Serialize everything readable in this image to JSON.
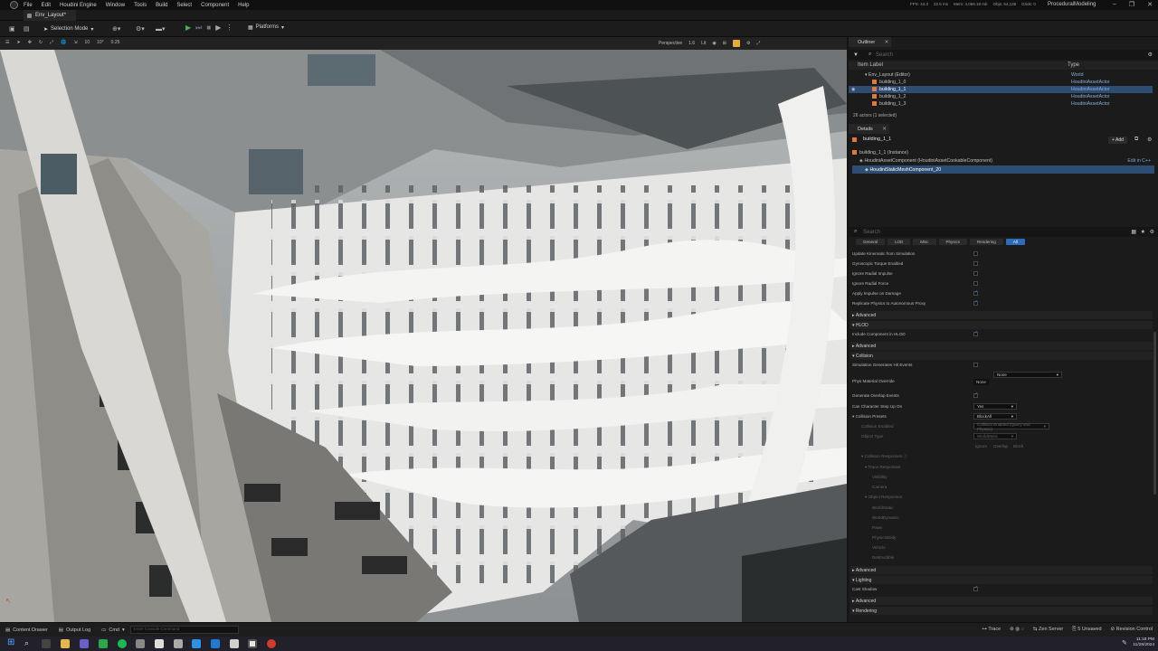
{
  "menubar": {
    "items": [
      "File",
      "Edit",
      "Houdini Engine",
      "Window",
      "Tools",
      "Build",
      "Select",
      "Component",
      "Help"
    ],
    "stats": {
      "fps": "FPS: 44.3",
      "ms": "22.6 ms",
      "mem": "Mem: 4,069.19 mb",
      "objs": "Objs: 54,138",
      "grids": "Grids: 0"
    },
    "project": "ProceduralModeling"
  },
  "level_tab": {
    "label": "Env_Layout*"
  },
  "toolbar": {
    "mode_label": "Selection Mode",
    "platforms_label": "Platforms"
  },
  "viewport_bar": {
    "perspective": "Perspective",
    "lit": "Lit",
    "scale": "1.6",
    "grid_snap": "10",
    "rot_snap": "10°",
    "scale_snap": "0.25"
  },
  "outliner": {
    "tab_label": "Outliner",
    "search_placeholder": "Search",
    "col_label": "Item Label",
    "col_type": "Type",
    "rows": [
      {
        "label": "Env_Layout (Editor)",
        "type": "World"
      },
      {
        "label": "building_1_0",
        "type": "HoudiniAssetActor"
      },
      {
        "label": "building_1_1",
        "type": "HoudiniAssetActor"
      },
      {
        "label": "building_1_2",
        "type": "HoudiniAssetActor"
      },
      {
        "label": "building_1_3",
        "type": "HoudiniAssetActor"
      }
    ],
    "footer": "26 actors (1 selected)"
  },
  "details": {
    "tab_label": "Details",
    "actor_name": "building_1_1",
    "add_label": "+ Add",
    "components": [
      {
        "label": "building_1_1 (Instance)"
      },
      {
        "label": "HoudiniAssetComponent (HoudiniAssetCookableComponent)",
        "extra": "Edit in C++"
      },
      {
        "label": "HoudiniStaticMeshComponent_20"
      }
    ],
    "search_placeholder": "Search",
    "filters": [
      "General",
      "LOD",
      "Misc",
      "Physics",
      "Rendering",
      "All"
    ],
    "physics_props": [
      "Update Kinematic from Simulation",
      "Gyroscopic Torque Enabled",
      "Ignore Radial Impulse",
      "Ignore Radial Force",
      "Apply Impulse on Damage",
      "Replicate Physics to Autonomous Proxy"
    ],
    "sections": {
      "advanced": "Advanced",
      "hlod": "HLOD",
      "hlod_prop": "Include Component in HLOD",
      "collision": "Collision",
      "lighting": "Lighting",
      "rendering": "Rendering"
    },
    "collision_props": {
      "sim_hit": "Simulation Generates Hit Events",
      "phys_mat": "Phys Material Override",
      "phys_mat_value": "None",
      "gen_overlap": "Generate Overlap Events",
      "step_up": "Can Character Step Up On",
      "step_up_value": "Yes",
      "presets": "Collision Presets",
      "presets_value": "BlockAll",
      "enabled": "Collision Enabled",
      "enabled_value": "Collision Enabled (Query and Physics)",
      "obj_type": "Object Type",
      "obj_type_value": "WorldStatic",
      "col_ignore": "Ignore",
      "col_overlap": "Overlap",
      "col_block": "Block",
      "responses": "Collision Responses",
      "trace": "Trace Responses",
      "visibility": "Visibility",
      "camera": "Camera",
      "object": "Object Responses",
      "world_static": "WorldStatic",
      "world_dynamic": "WorldDynamic",
      "pawn": "Pawn",
      "physics_body": "PhysicsBody",
      "vehicle": "Vehicle",
      "destructible": "Destructible"
    },
    "cast_shadow": "Cast Shadow"
  },
  "statusbar": {
    "content_drawer": "Content Drawer",
    "output_log": "Output Log",
    "cmd": "Cmd",
    "cmd_placeholder": "Enter Console Command",
    "trace": "Trace",
    "zen": "Zen Server",
    "unsaved": "5 Unsaved",
    "revision": "Revision Control"
  },
  "taskbar": {
    "time": "11:18 PM",
    "date": "11/25/2024"
  }
}
